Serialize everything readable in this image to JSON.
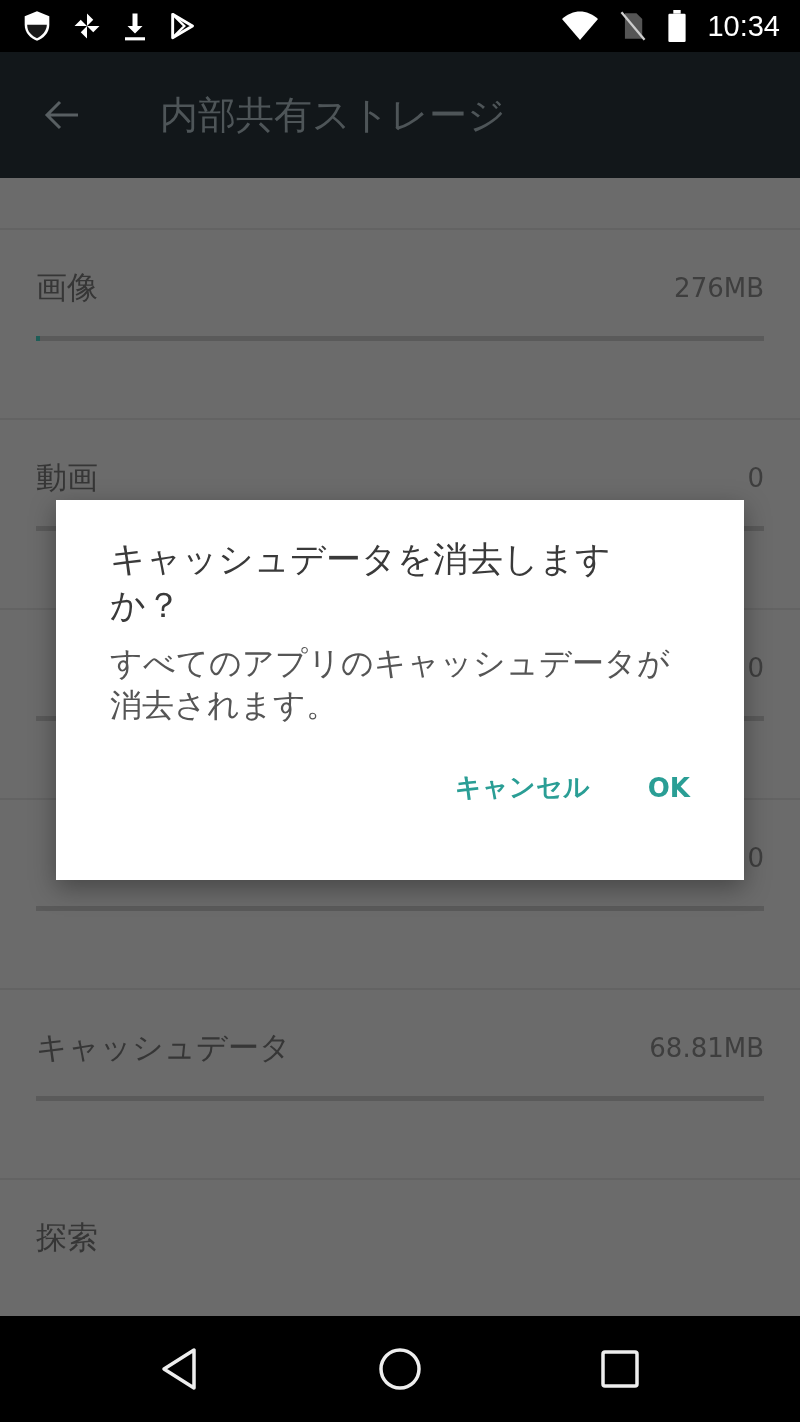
{
  "status_bar": {
    "time": "10:34"
  },
  "app_bar": {
    "title": "内部共有ストレージ"
  },
  "storage_items": [
    {
      "label": "画像",
      "size": "276MB",
      "level": 0.006
    },
    {
      "label": "動画",
      "size": "0"
    },
    {
      "size": "0"
    },
    {
      "size": "0"
    },
    {
      "label": "キャッシュデータ",
      "size": "68.81MB"
    },
    {
      "label": "探索"
    }
  ],
  "dialog": {
    "title": "キャッシュデータを消去しますか？",
    "message": "すべてのアプリのキャッシュデータが消去されます。",
    "buttons": [
      "キャンセル",
      "OK"
    ]
  }
}
